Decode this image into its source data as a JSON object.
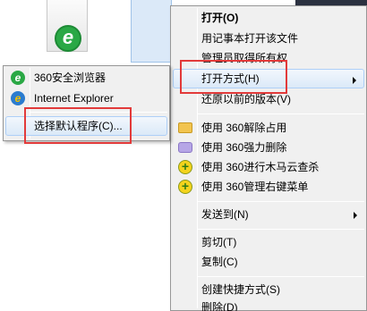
{
  "main_menu": {
    "items": [
      {
        "label": "打开(O)",
        "bold": true
      },
      {
        "label": "用记事本打开该文件"
      },
      {
        "label": "管理员取得所有权"
      },
      {
        "label": "打开方式(H)",
        "submenu": true,
        "highlighted": true
      },
      {
        "label": "还原以前的版本(V)"
      },
      {
        "label": "使用 360解除占用",
        "icon": "folder-icon"
      },
      {
        "label": "使用 360强力删除",
        "icon": "lock-icon"
      },
      {
        "label": "使用 360进行木马云查杀",
        "icon": "plus-icon"
      },
      {
        "label": "使用 360管理右键菜单",
        "icon": "plus-icon"
      },
      {
        "label": "发送到(N)",
        "submenu": true
      },
      {
        "label": "剪切(T)"
      },
      {
        "label": "复制(C)"
      },
      {
        "label": "创建快捷方式(S)"
      },
      {
        "label": "删除(D)"
      }
    ]
  },
  "open_with_menu": {
    "items": [
      {
        "label": "360安全浏览器",
        "icon": "360-browser-icon"
      },
      {
        "label": "Internet Explorer",
        "icon": "ie-icon"
      },
      {
        "label": "选择默认程序(C)..."
      }
    ]
  },
  "icons": {
    "browser_360_glyph": "e",
    "ie_glyph": "e",
    "plus_glyph": "+"
  },
  "colors": {
    "highlight_box": "#e23a3a",
    "menu_bg": "#f0f0f0",
    "hover_bg": "#dbe9f8"
  }
}
